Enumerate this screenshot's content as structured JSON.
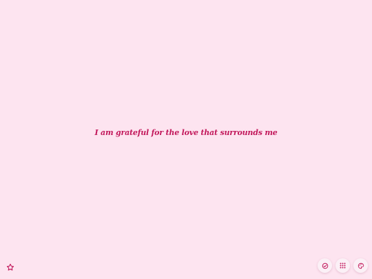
{
  "affirmation": {
    "text": "I am grateful for the love that surrounds me"
  },
  "colors": {
    "background": "#fde4f0",
    "accent": "#c2185b",
    "button_bg": "#fbf0f6"
  },
  "controls": {
    "favorite": {
      "icon": "star-icon"
    },
    "toolbar": [
      {
        "icon": "check-circle-icon"
      },
      {
        "icon": "grid-icon"
      },
      {
        "icon": "palette-icon"
      }
    ]
  }
}
